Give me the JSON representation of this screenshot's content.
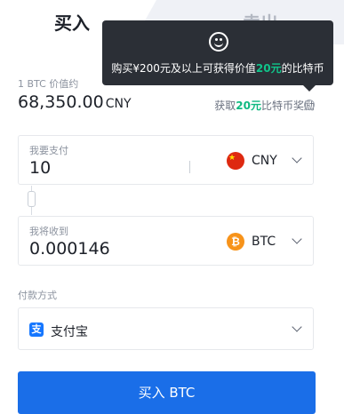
{
  "tabs": {
    "buy": "买入",
    "sell": "卖出"
  },
  "tooltip": {
    "prefix": "购买¥200元及以上可获得价值",
    "amount": "20元",
    "suffix": "的比特币"
  },
  "price": {
    "label": "1 BTC 价值约",
    "value": "68,350.00",
    "unit": "CNY"
  },
  "reward": {
    "prefix": "获取",
    "amount": "20元",
    "suffix": "比特币奖励",
    "info": "i"
  },
  "pay": {
    "label": "我要支付",
    "value": "10",
    "currency": "CNY"
  },
  "receive": {
    "label": "我将收到",
    "value": "0.000146",
    "currency": "BTC",
    "symbol": "₿"
  },
  "payment": {
    "label": "付款方式",
    "method": "支付宝",
    "icon_char": "支"
  },
  "buy_button": "买入 BTC",
  "colors": {
    "accent": "#1a6ee8",
    "green": "#10b981",
    "tooltip_bg": "#2b2f36"
  }
}
